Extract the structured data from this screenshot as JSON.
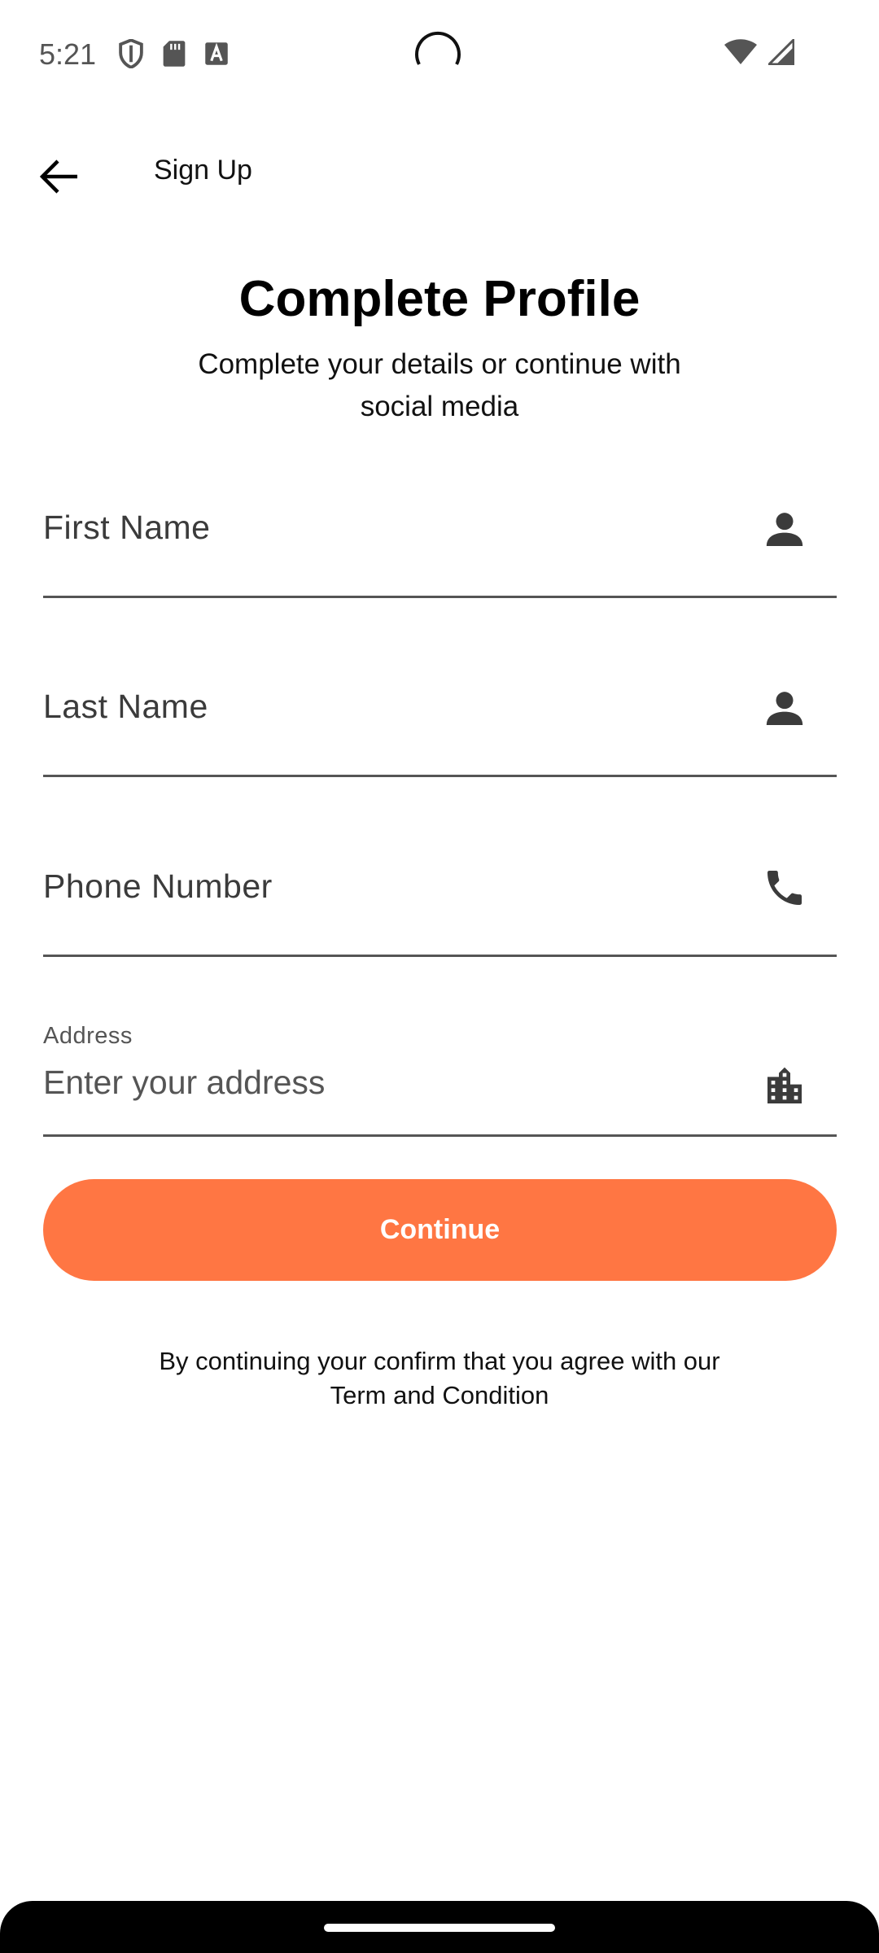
{
  "status_bar": {
    "time": "5:21",
    "icons_left": [
      "shield-icon",
      "sd-card-icon",
      "font-icon"
    ],
    "icons_right": [
      "wifi-icon",
      "cell-signal-icon"
    ]
  },
  "app_bar": {
    "title": "Sign Up",
    "back_icon": "arrow-back-icon"
  },
  "header": {
    "title": "Complete Profile",
    "subtitle": "Complete your details or continue with social media"
  },
  "form": {
    "first_name": {
      "label": "First Name",
      "icon": "person-icon",
      "value": ""
    },
    "last_name": {
      "label": "Last Name",
      "icon": "person-icon",
      "value": ""
    },
    "phone": {
      "label": "Phone Number",
      "icon": "phone-icon",
      "value": ""
    },
    "address": {
      "label": "Address",
      "placeholder": "Enter your address",
      "icon": "location-city-icon",
      "value": ""
    }
  },
  "continue_label": "Continue",
  "terms": "By continuing your confirm that you agree with our Term and Condition",
  "colors": {
    "accent": "#FF7643",
    "text": "#000000",
    "underline": "#555555"
  }
}
